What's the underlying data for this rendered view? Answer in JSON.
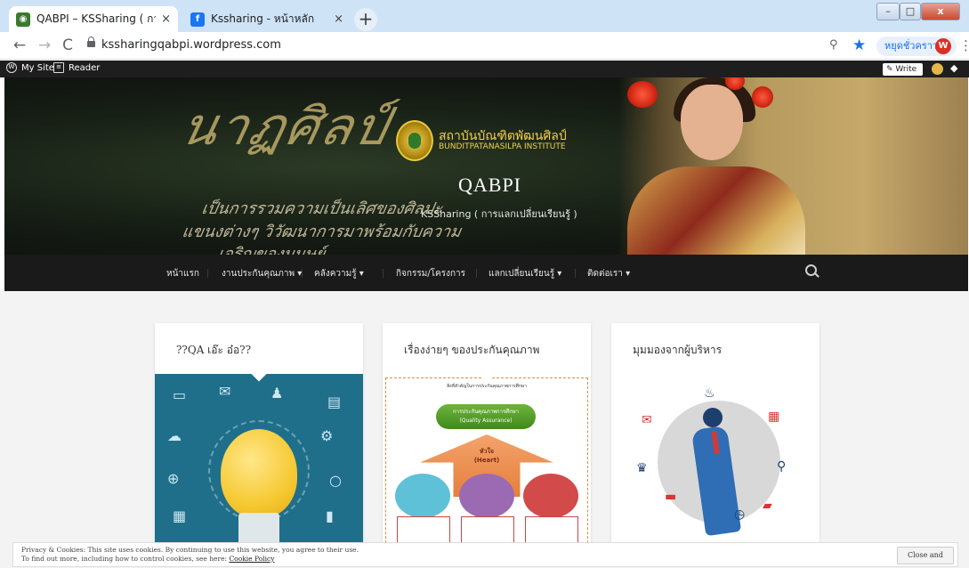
{
  "browser": {
    "tabs": [
      {
        "title": "QABPI – KSSharing ( การแลกเปลี่",
        "close": "×"
      },
      {
        "title": "Kssharing - หน้าหลัก",
        "close": "×"
      }
    ],
    "new_tab": "+",
    "url": "kssharingqabpi.wordpress.com",
    "profile_button": "หยุดชั่วคราว",
    "profile_initial": "W",
    "window_controls": {
      "minimize": "–",
      "maximize": "□",
      "close": "x"
    }
  },
  "wp_admin_bar": {
    "my_site": "My Site",
    "reader": "Reader",
    "write": "Write"
  },
  "header": {
    "institute_th": "สถาบันบัณฑิตพัฒนศิลป์",
    "institute_en": "BUNDITPATANASILPA INSTITUTE",
    "site_title": "QABPI",
    "tagline": "KSSharing ( การแลกเปลี่ยนเรียนรู้ )",
    "banner_script": "นาฏศิลป์",
    "banner_line1": "เป็นการรวมความเป็นเลิศของศิลปะ",
    "banner_line2": "แขนงต่างๆ วิวัฒนาการมาพร้อมกับความ",
    "banner_line3": "เจริญของมนุษย์"
  },
  "nav": {
    "items": [
      {
        "label": "หน้าแรก"
      },
      {
        "label": "งานประกันคุณภาพ ▾"
      },
      {
        "label": "คลังความรู้ ▾"
      },
      {
        "label": "กิจกรรม/โครงการ"
      },
      {
        "label": "แลกเปลี่ยนเรียนรู้ ▾"
      },
      {
        "label": "ติดต่อเรา ▾"
      }
    ]
  },
  "cards": [
    {
      "title": "??QA เอ๊ะ อ๋อ??"
    },
    {
      "title": "เรื่องง่ายๆ ของประกันคุณภาพ",
      "diagram": {
        "heading": "สิ่งที่สำคัญในการประกันคุณภาพการศึกษา",
        "pill_th": "การประกันคุณภาพการศึกษา",
        "pill_en": "(Quality Assurance)",
        "heart_th": "หัวใจ",
        "heart_en": "(Heart)"
      }
    },
    {
      "title": "มุมมองจากผู้บริหาร"
    }
  ],
  "cookie": {
    "line1": "Privacy & Cookies: This site uses cookies. By continuing to use this website, you agree to their use.",
    "line2_prefix": "To find out more, including how to control cookies, see here: ",
    "policy_link": "Cookie Policy",
    "close_button": "Close and accept"
  },
  "colors": {
    "tabstrip": "#cfe3f7",
    "wp_bar": "#1e1e1e",
    "nav_bg": "#1a1a1a",
    "content_bg": "#f3f3f3",
    "accent_blue": "#1a73e8"
  }
}
